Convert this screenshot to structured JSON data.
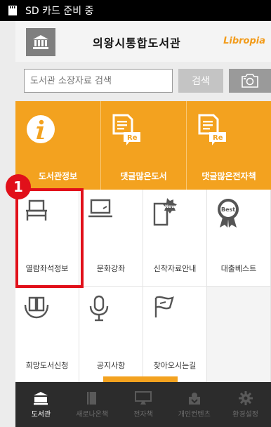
{
  "status_bar": {
    "text": "SD 카드 준비 중"
  },
  "header": {
    "title": "의왕시통합도서관",
    "brand": "Libropia"
  },
  "search": {
    "placeholder": "도서관 소장자료 검색",
    "button_label": "검색"
  },
  "orange_tiles": [
    {
      "label": "도서관정보",
      "icon": "info-icon"
    },
    {
      "label": "댓글많은도서",
      "icon": "document-re-icon"
    },
    {
      "label": "댓글많은전자책",
      "icon": "document-re-icon"
    }
  ],
  "grid_tiles": [
    {
      "label": "열람좌석정보",
      "icon": "chair-icon"
    },
    {
      "label": "문화강좌",
      "icon": "laptop-icon"
    },
    {
      "label": "신착자료안내",
      "icon": "tablet-new-icon"
    },
    {
      "label": "대출베스트",
      "icon": "best-medal-icon"
    },
    {
      "label": "희망도서신청",
      "icon": "book-hands-icon"
    },
    {
      "label": "공지사항",
      "icon": "microphone-icon"
    },
    {
      "label": "찾아오시는길",
      "icon": "flag-icon"
    }
  ],
  "annotation": {
    "badge": "1",
    "highlight_color": "#e1101a"
  },
  "bottom_nav": [
    {
      "label": "도서관",
      "icon": "library-icon",
      "active": true
    },
    {
      "label": "새로나온책",
      "icon": "new-book-icon",
      "active": false
    },
    {
      "label": "전자책",
      "icon": "monitor-icon",
      "active": false
    },
    {
      "label": "개인컨텐츠",
      "icon": "personal-content-icon",
      "active": false
    },
    {
      "label": "환경설정",
      "icon": "gear-icon",
      "active": false
    }
  ],
  "colors": {
    "accent": "#f3a21f",
    "brand": "#f29b1a",
    "nav_bg": "#2c2c2c",
    "highlight": "#e1101a"
  }
}
